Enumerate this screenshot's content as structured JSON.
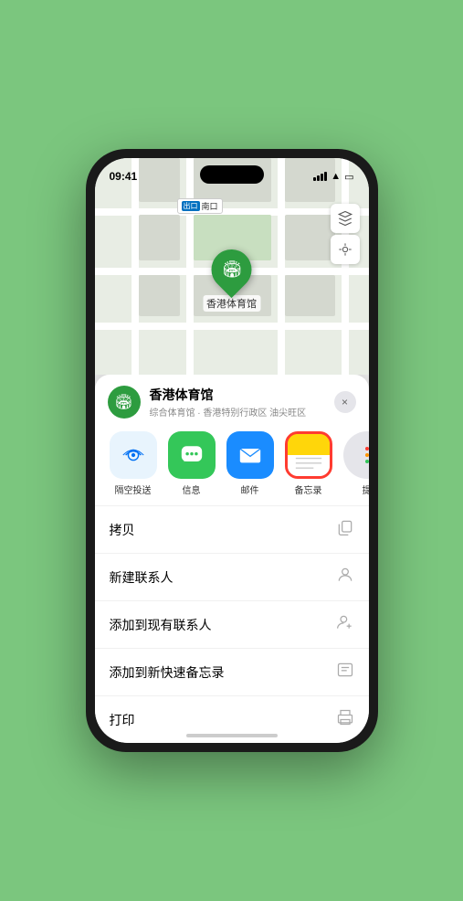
{
  "status_bar": {
    "time": "09:41",
    "location_arrow": "▶"
  },
  "map": {
    "label_tag": "出口",
    "label_text": "南口",
    "marker_label": "香港体育馆"
  },
  "map_controls": {
    "layers_icon": "🗺",
    "location_icon": "⊕"
  },
  "place_info": {
    "name": "香港体育馆",
    "subtitle": "综合体育馆 · 香港特别行政区 油尖旺区"
  },
  "share_items": [
    {
      "id": "airdrop",
      "label": "隔空投送",
      "icon": "📡"
    },
    {
      "id": "messages",
      "label": "信息",
      "icon": "💬"
    },
    {
      "id": "mail",
      "label": "邮件",
      "icon": "✉"
    },
    {
      "id": "notes",
      "label": "备忘录",
      "icon": "📝"
    },
    {
      "id": "more",
      "label": "提",
      "icon": "···"
    }
  ],
  "actions": [
    {
      "id": "copy",
      "label": "拷贝",
      "icon": "⎘"
    },
    {
      "id": "new-contact",
      "label": "新建联系人",
      "icon": "👤"
    },
    {
      "id": "add-existing",
      "label": "添加到现有联系人",
      "icon": "👤+"
    },
    {
      "id": "quick-note",
      "label": "添加到新快速备忘录",
      "icon": "📋"
    },
    {
      "id": "print",
      "label": "打印",
      "icon": "🖨"
    }
  ],
  "close_label": "×"
}
